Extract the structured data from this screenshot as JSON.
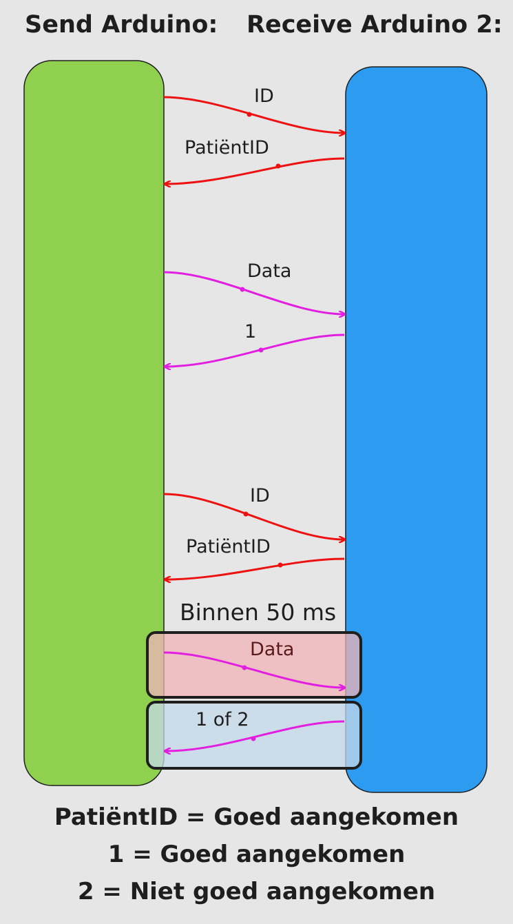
{
  "titles": {
    "left": "Send Arduino:",
    "right": "Receive Arduino 2:"
  },
  "colors": {
    "background": "#e6e6e6",
    "sender_block": "#8fd14f",
    "receiver_block": "#2d9bf0",
    "handshake_arrow": "#ee1111",
    "data_arrow": "#e21fe0",
    "highlight_red": "#f0b3b8",
    "highlight_blue": "#c4d8ea"
  },
  "messages": [
    {
      "label": "ID",
      "direction": "send",
      "color": "red"
    },
    {
      "label": "PatiëntID",
      "direction": "receive",
      "color": "red"
    },
    {
      "label": "Data",
      "direction": "send",
      "color": "magenta"
    },
    {
      "label": "1",
      "direction": "receive",
      "color": "magenta"
    },
    {
      "label": "ID",
      "direction": "send",
      "color": "red"
    },
    {
      "label": "PatiëntID",
      "direction": "receive",
      "color": "red"
    },
    {
      "label": "Data",
      "direction": "send",
      "color": "magenta"
    },
    {
      "label": "1 of 2",
      "direction": "receive",
      "color": "magenta"
    }
  ],
  "timing_note": "Binnen 50 ms",
  "legend": [
    "PatiëntID = Goed aangekomen",
    "1 = Goed aangekomen",
    "2 = Niet goed aangekomen"
  ]
}
